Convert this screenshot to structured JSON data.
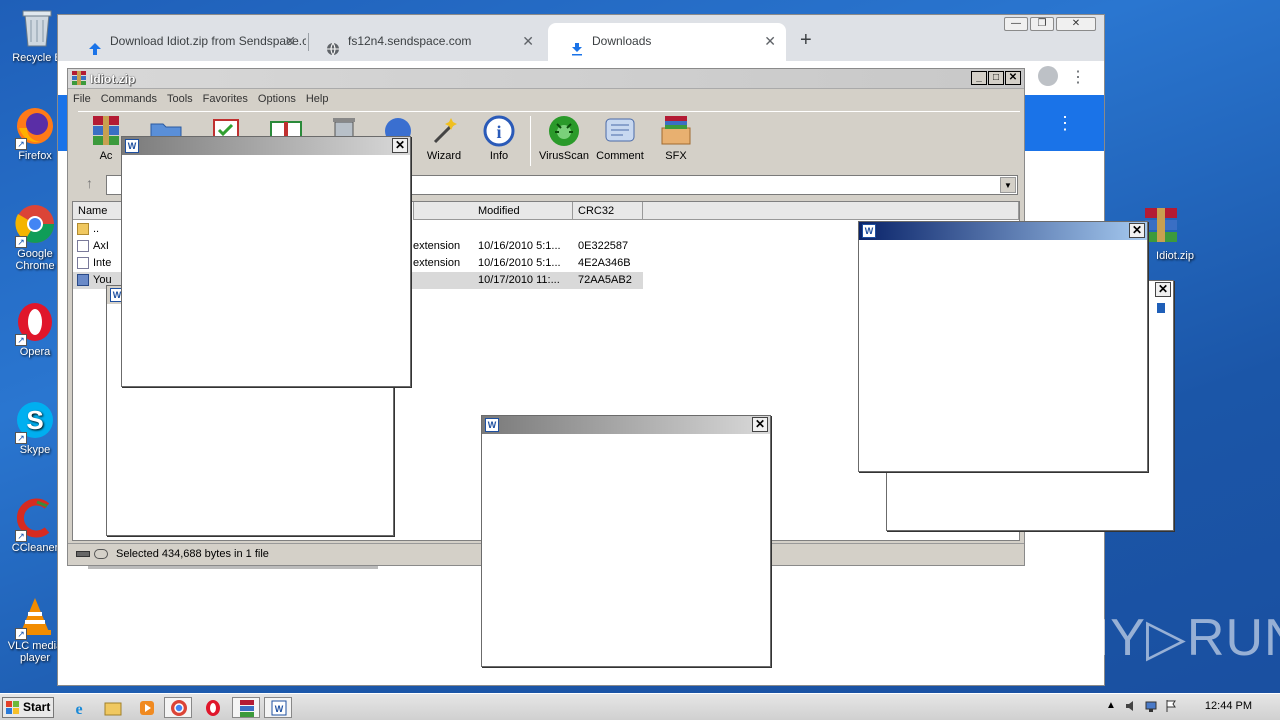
{
  "desktop": {
    "icons": [
      {
        "label": "Recycle Bin",
        "icon": "recycle-bin-icon"
      },
      {
        "label": "Firefox",
        "icon": "firefox-icon"
      },
      {
        "label": "Google Chrome",
        "icon": "chrome-icon"
      },
      {
        "label": "Opera",
        "icon": "opera-icon"
      },
      {
        "label": "Skype",
        "icon": "skype-icon"
      },
      {
        "label": "CCleaner",
        "icon": "ccleaner-icon"
      },
      {
        "label": "VLC media player",
        "icon": "vlc-icon"
      }
    ],
    "zip_icon_label": "Idiot.zip",
    "recycle_label": "Recycle B"
  },
  "chrome": {
    "tabs": [
      {
        "label": "Download Idiot.zip from Sendspace.c",
        "icon": "upload-arrow-icon"
      },
      {
        "label": "fs12n4.sendspace.com",
        "icon": "globe-icon"
      },
      {
        "label": "Downloads",
        "icon": "download-icon"
      }
    ],
    "new_tab": "+",
    "close": "✕",
    "min": "—",
    "max": "❐",
    "menu": "⋮",
    "accent": "#1a73e8"
  },
  "winrar": {
    "title": "Idiot.zip",
    "menu": [
      "File",
      "Commands",
      "Tools",
      "Favorites",
      "Options",
      "Help"
    ],
    "toolbar": [
      {
        "label": "Ac",
        "icon": "add-icon"
      },
      {
        "label": "",
        "icon": "extract-icon"
      },
      {
        "label": "",
        "icon": "test-icon"
      },
      {
        "label": "",
        "icon": "view-icon"
      },
      {
        "label": "",
        "icon": "delete-icon"
      },
      {
        "label": "",
        "icon": "find-icon"
      },
      {
        "label": "Wizard",
        "icon": "wizard-icon"
      },
      {
        "label": "Info",
        "icon": "info-icon"
      },
      {
        "label": "VirusScan",
        "icon": "virusscan-icon"
      },
      {
        "label": "Comment",
        "icon": "comment-icon"
      },
      {
        "label": "SFX",
        "icon": "sfx-icon"
      }
    ],
    "columns": [
      "Name",
      "Modified",
      "CRC32"
    ],
    "rows": [
      {
        "name": "..",
        "type": "",
        "modified": "",
        "crc": ""
      },
      {
        "name": "AxI",
        "type": "extension",
        "modified": "10/16/2010 5:1...",
        "crc": "0E322587"
      },
      {
        "name": "Inte",
        "type": "extension",
        "modified": "10/16/2010 5:1...",
        "crc": "4E2A346B"
      },
      {
        "name": "You",
        "type": "",
        "modified": "10/17/2010 11:...",
        "crc": "72AA5AB2"
      }
    ],
    "status": "Selected 434,688 bytes in 1 file",
    "up_arrow": "↑",
    "dropdown": "▼"
  },
  "taskbar": {
    "start": "Start",
    "clock": "12:44 PM",
    "tray_up": "▲"
  },
  "watermark": "ANY▷RUN"
}
